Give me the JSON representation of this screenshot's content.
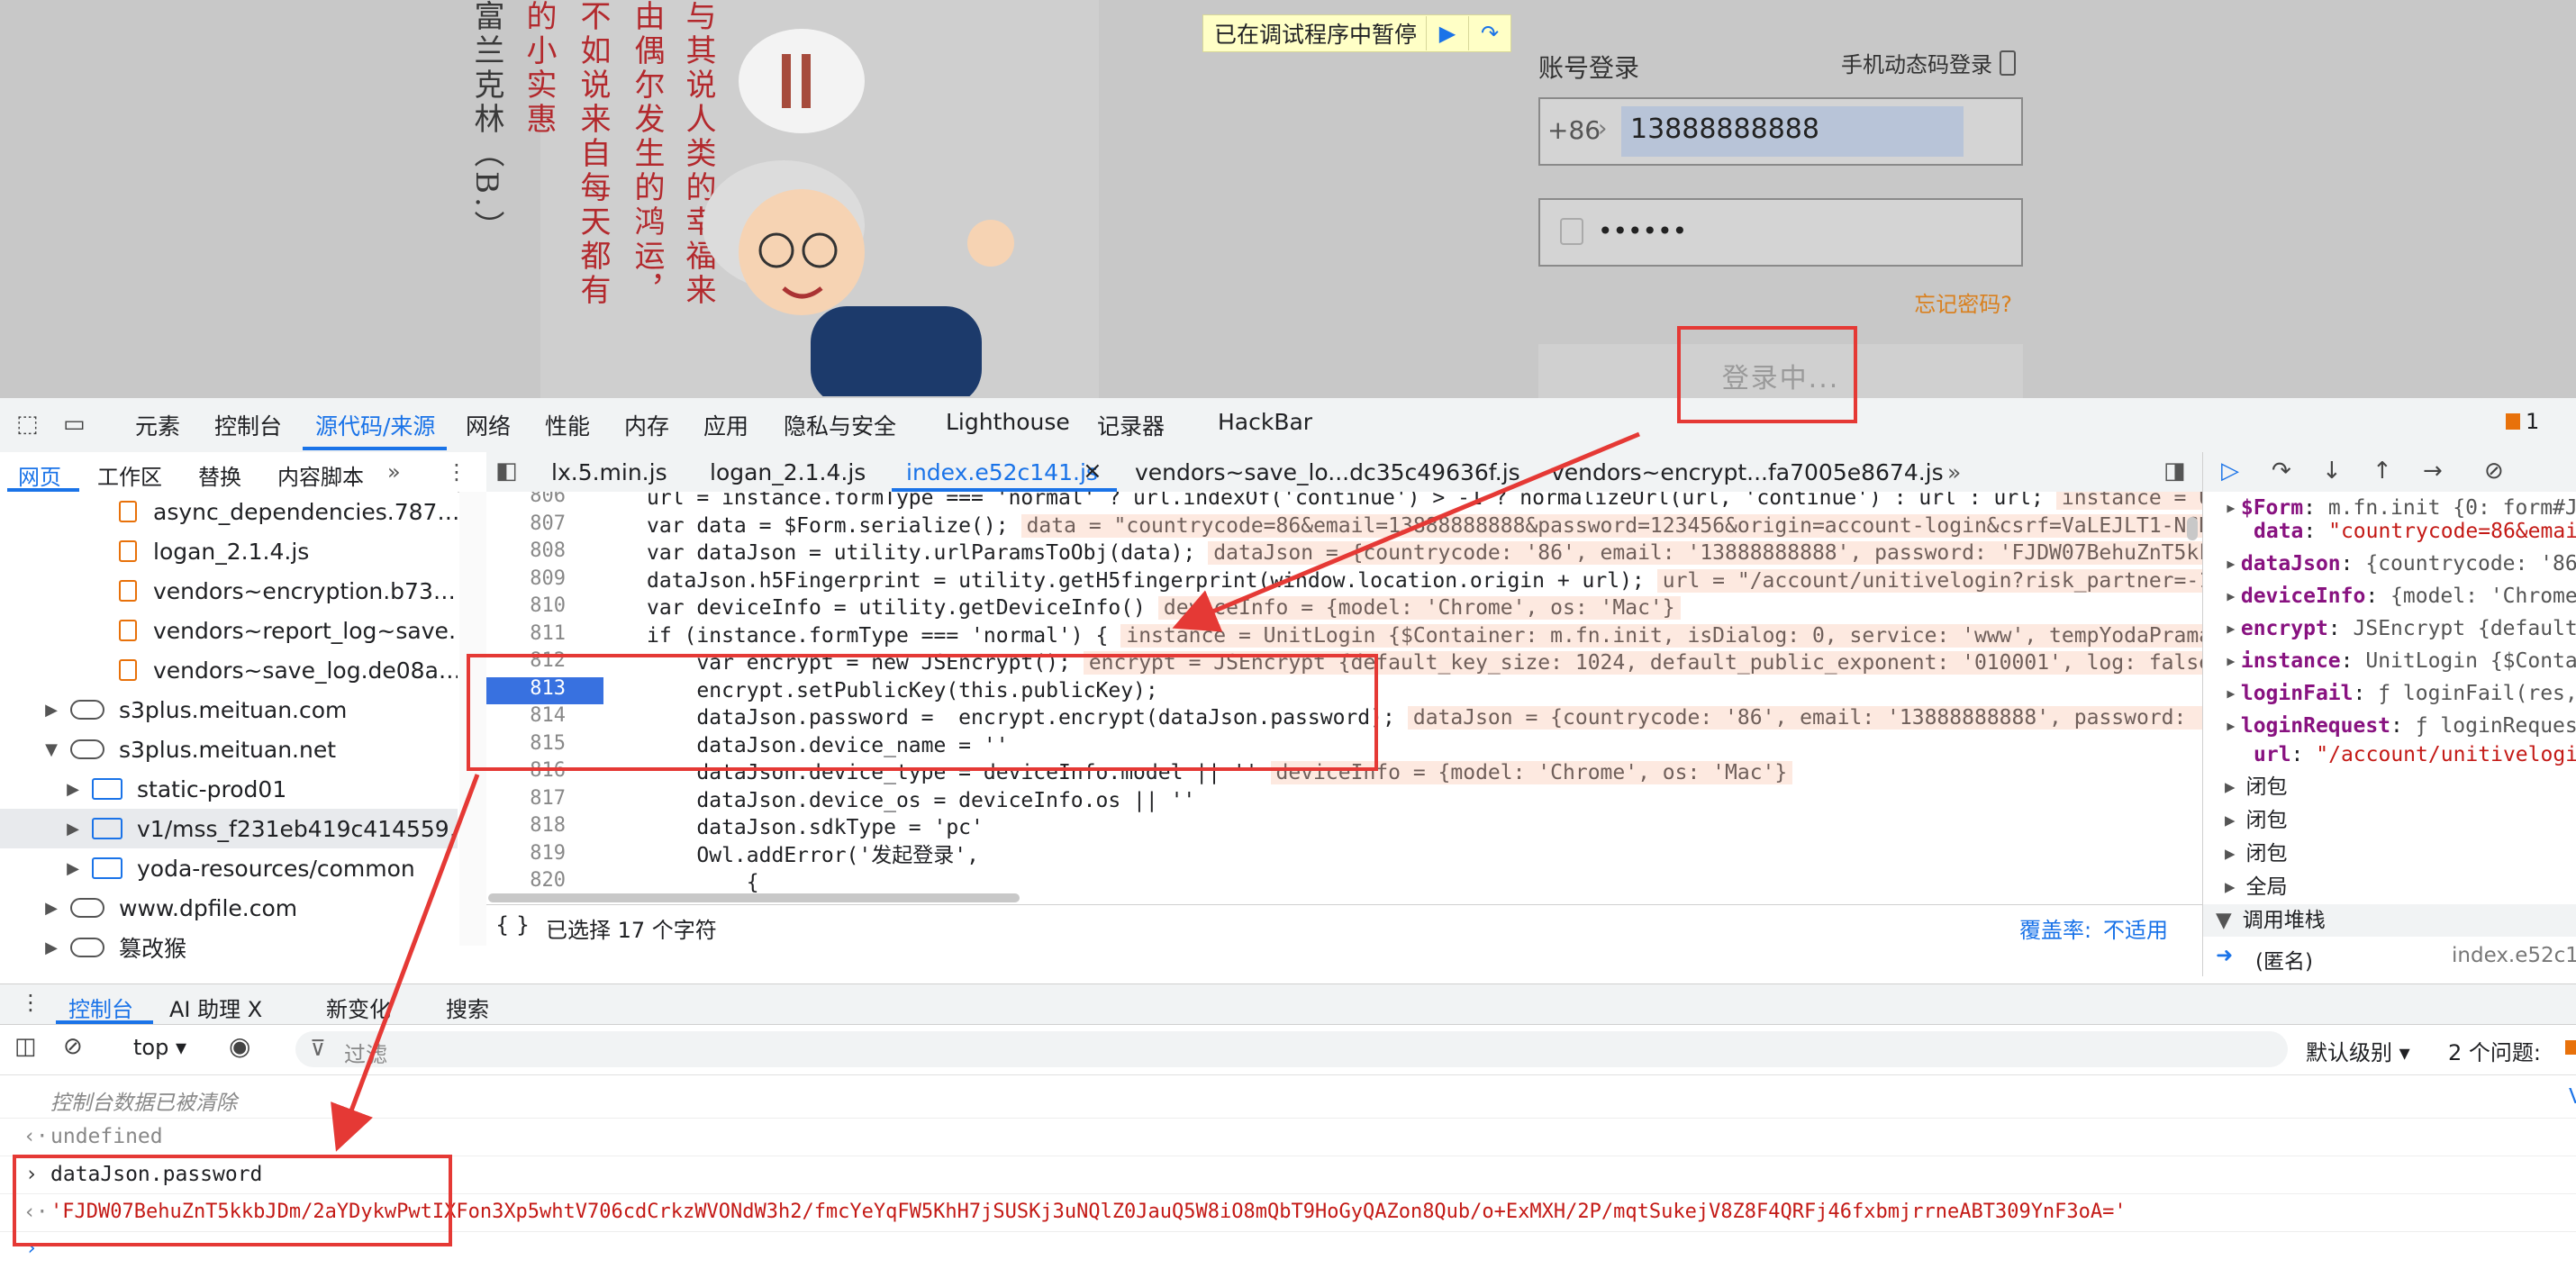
{
  "page": {
    "art_columns": [
      "富兰克林（B.）",
      "的小实惠",
      "不如说来自每天都有",
      "由偶尔发生的鸿运，",
      "与其说人类的幸福来"
    ],
    "pause_banner": "已在调试程序中暂停",
    "login": {
      "title": "账号登录",
      "sms_login": "手机动态码登录",
      "country_code": "+86",
      "phone": "13888888888",
      "password_mask": "••••••",
      "forgot": "忘记密码?",
      "submit": "登录中..."
    }
  },
  "devtools": {
    "main_tabs": [
      "元素",
      "控制台",
      "源代码/来源",
      "网络",
      "性能",
      "内存",
      "应用",
      "隐私与安全",
      "Lighthouse",
      "记录器",
      "HackBar"
    ],
    "issues_count": "1",
    "nav_tabs": [
      "网页",
      "工作区",
      "替换",
      "内容脚本"
    ],
    "nav_tree": [
      {
        "label": "async_dependencies.787…",
        "kind": "file"
      },
      {
        "label": "logan_2.1.4.js",
        "kind": "file"
      },
      {
        "label": "vendors~encryption.b73…",
        "kind": "file"
      },
      {
        "label": "vendors~report_log~save…",
        "kind": "file"
      },
      {
        "label": "vendors~save_log.de08a…",
        "kind": "file"
      },
      {
        "label": "s3plus.meituan.com",
        "kind": "cloud",
        "expanded": false
      },
      {
        "label": "s3plus.meituan.net",
        "kind": "cloud",
        "expanded": true
      },
      {
        "label": "static-prod01",
        "kind": "folder"
      },
      {
        "label": "v1/mss_f231eb419c414559…",
        "kind": "folder",
        "selected": true
      },
      {
        "label": "yoda-resources/common",
        "kind": "folder"
      },
      {
        "label": "www.dpfile.com",
        "kind": "cloud",
        "expanded": false
      },
      {
        "label": "篡改猴",
        "kind": "cloud",
        "expanded": false
      }
    ],
    "editor_tabs": [
      {
        "label": "lx.5.min.js"
      },
      {
        "label": "logan_2.1.4.js"
      },
      {
        "label": "index.e52c141.js",
        "active": true
      },
      {
        "label": "vendors~save_lo...dc35c49636f.js"
      },
      {
        "label": "vendors~encrypt...fa7005e8674.js"
      }
    ],
    "code_lines": [
      {
        "num": "806",
        "code": "url = instance.formType === 'normal' ? url.indexOf('continue') > -1 ? normalizeUrl(url, 'continue') : url : url;",
        "inline": "instance = Uni"
      },
      {
        "num": "807",
        "code": "var data = $Form.serialize();",
        "inline": "data = \"countrycode=86&email=13888888888&password=123456&origin=account-login&csrf=VaLEJLT1-NGRYA"
      },
      {
        "num": "808",
        "code": "var dataJson = utility.urlParamsToObj(data);",
        "inline": "dataJson = {countrycode: '86', email: '13888888888', password: 'FJDW07BehuZnT5kkbJ"
      },
      {
        "num": "809",
        "code": "dataJson.h5Fingerprint = utility.getH5fingerprint(window.location.origin + url);",
        "inline": "url = \"/account/unitivelogin?risk_partner=-1&r"
      },
      {
        "num": "810",
        "code": "var deviceInfo = utility.getDeviceInfo()",
        "inline": "deviceInfo = {model: 'Chrome', os: 'Mac'}"
      },
      {
        "num": "811",
        "code": "if (instance.formType === 'normal') {",
        "inline": "instance = UnitLogin {$Container: m.fn.init, isDialog: 0, service: 'www', tempYodaPrama:"
      },
      {
        "num": "812",
        "code": "    var encrypt = new JSEncrypt();",
        "inline": "encrypt = JSEncrypt {default_key_size: 1024, default_public_exponent: '010001', log: false,"
      },
      {
        "num": "813",
        "code": "    encrypt.setPublicKey(this.publicKey);",
        "inline": "",
        "breakpoint": true
      },
      {
        "num": "814",
        "code": "    dataJson.password =  encrypt.encrypt(dataJson.password);",
        "inline": "dataJson = {countrycode: '86', email: '13888888888', password: 'FJ"
      },
      {
        "num": "815",
        "code": "    dataJson.device_name = ''",
        "inline": ""
      },
      {
        "num": "816",
        "code": "    dataJson.device_type = deviceInfo.model || ''",
        "inline": "deviceInfo = {model: 'Chrome', os: 'Mac'}"
      },
      {
        "num": "817",
        "code": "    dataJson.device_os = deviceInfo.os || ''",
        "inline": ""
      },
      {
        "num": "818",
        "code": "    dataJson.sdkType = 'pc'",
        "inline": ""
      },
      {
        "num": "819",
        "code": "    Owl.addError('发起登录',",
        "inline": ""
      },
      {
        "num": "820",
        "code": "        {",
        "inline": ""
      }
    ],
    "status": {
      "selection": "已选择 17 个字符",
      "coverage_label": "覆盖率:",
      "coverage_value": "不适用"
    },
    "scope_rows": [
      {
        "key": "$Form",
        "val": "m.fn.init {0: form#J"
      },
      {
        "key": "data",
        "val": "\"countrycode=86&email"
      },
      {
        "key": "dataJson",
        "val": "{countrycode: '86"
      },
      {
        "key": "deviceInfo",
        "val": "{model: 'Chrome"
      },
      {
        "key": "encrypt",
        "val": "JSEncrypt {default"
      },
      {
        "key": "instance",
        "val": "UnitLogin {$Conta"
      },
      {
        "key": "loginFail",
        "val": "ƒ loginFail(res,"
      },
      {
        "key": "loginRequest",
        "val": "ƒ loginRequest"
      },
      {
        "key": "url",
        "val": "\"/account/unitivelogin"
      }
    ],
    "scope_sections": [
      "闭包",
      "闭包",
      "闭包",
      "全局"
    ],
    "callstack_title": "调用堆栈",
    "callstack_frame": {
      "name": "(匿名)",
      "file": "index.e52c14"
    },
    "drawer_tabs": [
      "控制台",
      "AI 助理 Ⅹ",
      "新变化",
      "搜索"
    ],
    "console_toolbar": {
      "context": "top",
      "filter_placeholder": "过滤",
      "level": "默认级别",
      "issues": "2 个问题:"
    },
    "console": {
      "cleared": "控制台数据已被清除",
      "undefined": "undefined",
      "input": "dataJson.password",
      "output": "'FJDW07BehuZnT5kkbJDm/2aYDykwPwtIXFon3Xp5whtV706cdCrkzWVONdW3h2/fmcYeYqFW5KhH7jSUSKj3uNQlZ0JauQ5W8iO8mQbT9HoGyQAZon8Qub/o+ExMXH/2P/mqtSukejV8Z8F4QRFj46fxbmjrrneABT309YnF3oA='",
      "right_link": "V"
    }
  }
}
